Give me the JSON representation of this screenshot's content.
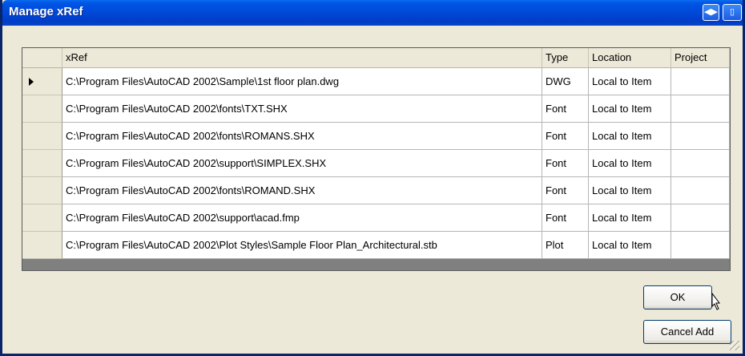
{
  "window": {
    "title": "Manage xRef"
  },
  "grid": {
    "columns": [
      "xRef",
      "Type",
      "Location",
      "Project"
    ],
    "rows": [
      {
        "xref": "C:\\Program Files\\AutoCAD 2002\\Sample\\1st floor plan.dwg",
        "type": "DWG",
        "location": "Local to Item",
        "project": ""
      },
      {
        "xref": "C:\\Program Files\\AutoCAD 2002\\fonts\\TXT.SHX",
        "type": "Font",
        "location": "Local to Item",
        "project": ""
      },
      {
        "xref": "C:\\Program Files\\AutoCAD 2002\\fonts\\ROMANS.SHX",
        "type": "Font",
        "location": "Local to Item",
        "project": ""
      },
      {
        "xref": "C:\\Program Files\\AutoCAD 2002\\support\\SIMPLEX.SHX",
        "type": "Font",
        "location": "Local to Item",
        "project": ""
      },
      {
        "xref": "C:\\Program Files\\AutoCAD 2002\\fonts\\ROMAND.SHX",
        "type": "Font",
        "location": "Local to Item",
        "project": ""
      },
      {
        "xref": "C:\\Program Files\\AutoCAD 2002\\support\\acad.fmp",
        "type": "Font",
        "location": "Local to Item",
        "project": ""
      },
      {
        "xref": "C:\\Program Files\\AutoCAD 2002\\Plot Styles\\Sample Floor Plan_Architectural.stb",
        "type": "Plot",
        "location": "Local to Item",
        "project": ""
      }
    ]
  },
  "buttons": {
    "ok": "OK",
    "cancel_add": "Cancel Add"
  }
}
